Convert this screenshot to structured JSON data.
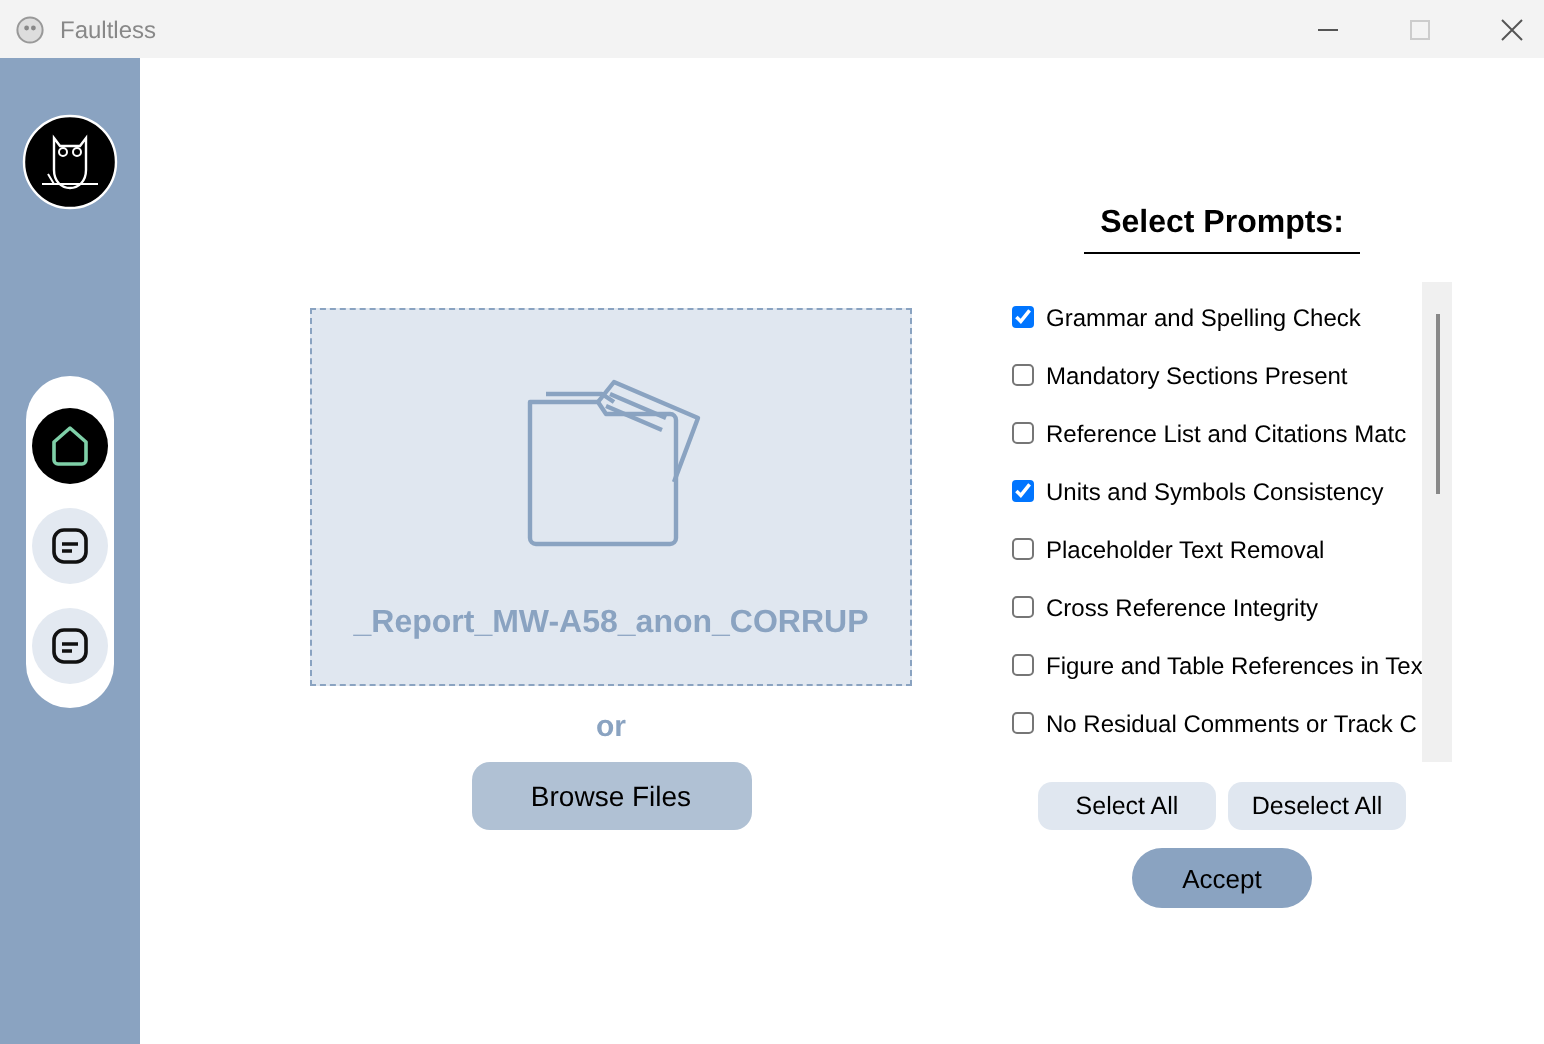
{
  "window": {
    "title": "Faultless"
  },
  "sidebar": {
    "nav": [
      {
        "kind": "home",
        "selected": true
      },
      {
        "kind": "document",
        "selected": false
      },
      {
        "kind": "document",
        "selected": false
      }
    ]
  },
  "upload": {
    "file_name": "_Report_MW-A58_anon_CORRUP",
    "or_label": "or",
    "browse_button": "Browse Files"
  },
  "prompts": {
    "heading": "Select Prompts:",
    "items": [
      {
        "label": "Grammar and Spelling Check",
        "checked": true
      },
      {
        "label": "Mandatory Sections Present",
        "checked": false
      },
      {
        "label": "Reference List and Citations Matc",
        "checked": false
      },
      {
        "label": "Units and Symbols Consistency",
        "checked": true
      },
      {
        "label": "Placeholder Text Removal",
        "checked": false
      },
      {
        "label": "Cross Reference Integrity",
        "checked": false
      },
      {
        "label": "Figure and Table References in Tex",
        "checked": false
      },
      {
        "label": "No Residual Comments or Track C",
        "checked": false
      }
    ],
    "select_all": "Select All",
    "deselect_all": "Deselect All",
    "accept": "Accept"
  }
}
